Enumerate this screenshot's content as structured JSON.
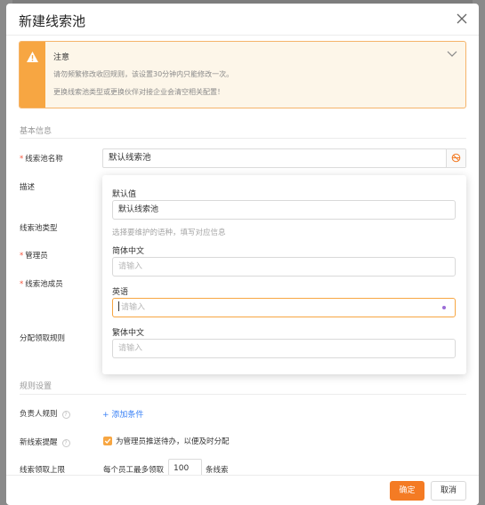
{
  "modal": {
    "title": "新建线索池"
  },
  "notice": {
    "title": "注意",
    "line1": "请勿频繁修改收回规则，该设置30分钟内只能修改一次。",
    "line2": "更换线索池类型或更换伙伴对接企业会清空相关配置！"
  },
  "sections": {
    "basic": "基本信息",
    "rules": "规则设置"
  },
  "fields": {
    "name_label": "线索池名称",
    "name_value": "默认线索池",
    "description_label": "描述",
    "type_label": "线索池类型",
    "admin_label": "管理员",
    "members_label": "线索池成员",
    "assign_rule_label": "分配领取规则",
    "owner_rule_label": "负责人规则",
    "add_condition": "+ 添加条件",
    "reminder_label": "新线索提醒",
    "reminder_checkbox_label": "为管理员推送待办，以便及时分配",
    "limit_label": "线索领取上限",
    "limit_prefix": "每个员工最多领取",
    "limit_value": "100",
    "limit_suffix": "条线索"
  },
  "translation_popover": {
    "default_label": "默认值",
    "default_value": "默认线索池",
    "hint": "选择要维护的语种，填写对应信息",
    "languages": [
      {
        "label": "简体中文",
        "placeholder": "请输入"
      },
      {
        "label": "英语",
        "placeholder": "请输入"
      },
      {
        "label": "繁体中文",
        "placeholder": "请输入"
      }
    ]
  },
  "footer": {
    "ok": "确定",
    "cancel": "取消"
  },
  "colors": {
    "accent": "#f47b24",
    "warning": "#f7a642",
    "link": "#3b82f6",
    "required": "#f5543c"
  }
}
